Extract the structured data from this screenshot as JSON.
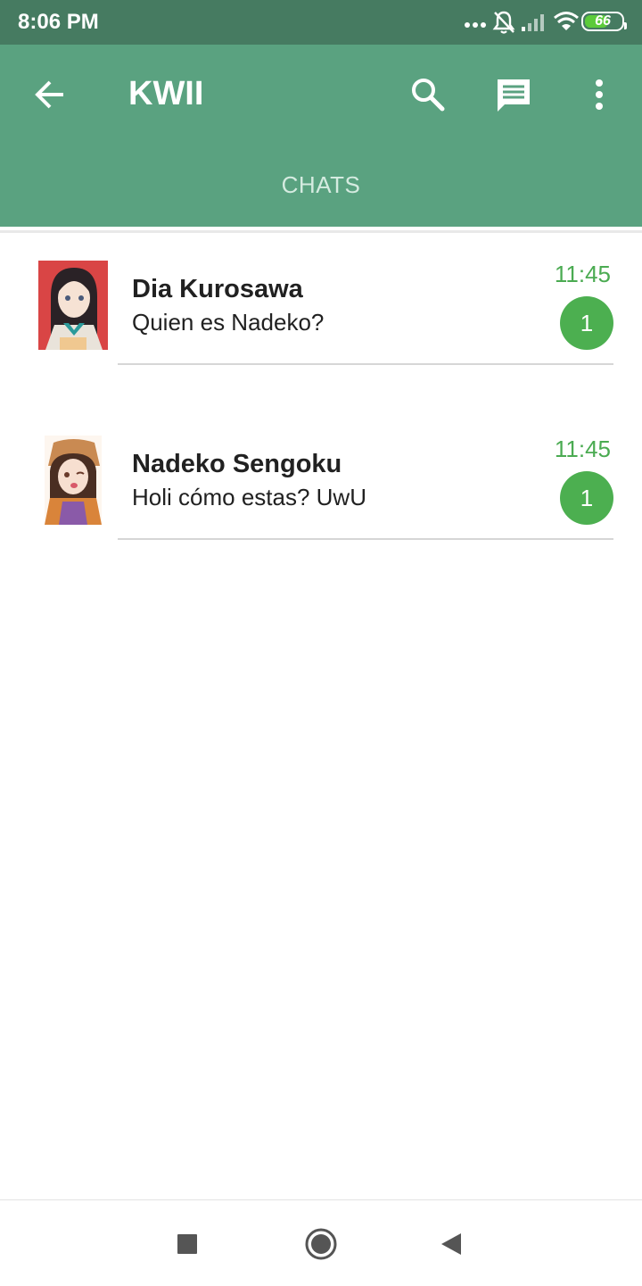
{
  "status_bar": {
    "time": "8:06 PM",
    "icons": [
      "more-dots-icon",
      "notifications-off-icon",
      "signal-icon",
      "wifi-icon",
      "battery-icon"
    ],
    "battery_level": "66",
    "battery_fraction": 0.66
  },
  "app_bar": {
    "title": "KWII",
    "icons": [
      "back-arrow-icon",
      "search-icon",
      "message-icon",
      "more-vert-icon"
    ],
    "tab_label": "CHATS"
  },
  "chats": [
    {
      "name": "Dia Kurosawa",
      "preview": "Quien es Nadeko?",
      "time": "11:45",
      "unread": "1"
    },
    {
      "name": "Nadeko Sengoku",
      "preview": "Holi cómo estas? UwU",
      "time": "11:45",
      "unread": "1"
    }
  ],
  "nav_bar": {
    "icons": [
      "recent-apps-square-icon",
      "home-circle-icon",
      "back-triangle-icon"
    ]
  },
  "colors": {
    "status_bar": "#467b61",
    "app_bar": "#5aa280",
    "accent_green": "#4caf50",
    "time_green": "#4bab52"
  }
}
